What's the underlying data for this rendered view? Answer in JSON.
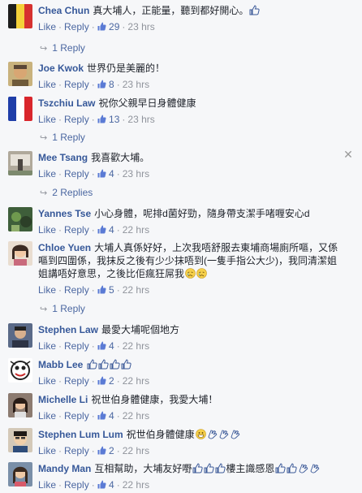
{
  "ui": {
    "like_label": "Like",
    "reply_label": "Reply",
    "dot": "·"
  },
  "comments": [
    {
      "name": "Chea Chun",
      "text": "真大埔人，正能量，聽到都好開心。",
      "likes": "29",
      "time": "23 hrs",
      "replies": "1 Reply",
      "emojis": [
        "thumbs-up"
      ]
    },
    {
      "name": "Joe Kwok",
      "text": "世界仍是美麗的！",
      "likes": "8",
      "time": "23 hrs"
    },
    {
      "name": "Tszchiu Law",
      "text": "祝你父親早日身體健康",
      "likes": "13",
      "time": "23 hrs",
      "replies": "1 Reply"
    },
    {
      "name": "Mee Tsang",
      "text": "我喜歡大埔。",
      "likes": "4",
      "time": "23 hrs",
      "replies": "2 Replies"
    },
    {
      "name": "Yannes Tse",
      "text": "小心身體，呢排d菌好勁，隨身帶支潔手啫喱安心d",
      "likes": "4",
      "time": "22 hrs"
    },
    {
      "name": "Chloe Yuen",
      "text": "大埔人真係好好，上次我唔舒服去東埔商場廁所嘔，又係嘔到四圍係，我抹反之後有少少抹唔到(一隻手指公大少)，我同清潔姐姐講唔好意思，之後比佢瘋狂屌我",
      "likes": "5",
      "time": "22 hrs",
      "replies": "1 Reply",
      "emojis": [
        "crying",
        "crying"
      ]
    },
    {
      "name": "Stephen Law",
      "text": "最愛大埔呢個地方",
      "likes": "4",
      "time": "22 hrs"
    },
    {
      "name": "Mabb Lee",
      "text": "",
      "likes": "2",
      "time": "22 hrs",
      "emojis": [
        "thumbs-up",
        "thumbs-up",
        "thumbs-up",
        "thumbs-up"
      ]
    },
    {
      "name": "Michelle Li",
      "text": "祝世伯身體健康，我愛大埔！",
      "likes": "4",
      "time": "22 hrs"
    },
    {
      "name": "Stephen Lum Lum",
      "text": "祝世伯身體健康",
      "likes": "2",
      "time": "22 hrs",
      "emojis": [
        "grinning",
        "clapping",
        "clapping",
        "clapping"
      ]
    },
    {
      "name": "Mandy Man",
      "text": "互相幫助，大埔友好嘢",
      "text2": "樓主識感恩",
      "likes": "4",
      "time": "22 hrs",
      "emojis": [
        "thumbs-up",
        "thumbs-up",
        "thumbs-up"
      ],
      "emojis2": [
        "thumbs-up",
        "thumbs-up",
        "clapping",
        "clapping"
      ]
    }
  ],
  "colors": {
    "link": "#4b67a1",
    "name": "#365899",
    "meta": "#90949c",
    "background": "#f6f7f9",
    "emoji_outline": "#3b5998"
  }
}
